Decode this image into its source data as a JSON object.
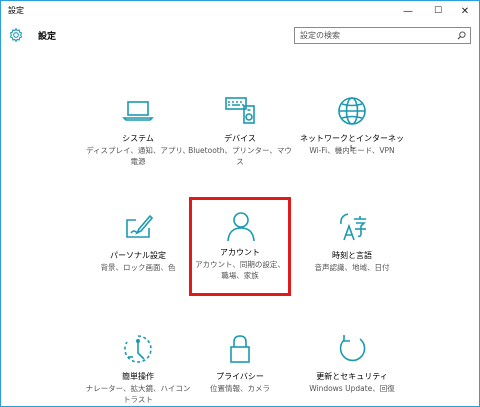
{
  "window": {
    "title": "設定",
    "minimize": "—",
    "maximize": "☐",
    "close": "✕"
  },
  "header": {
    "app_title": "設定",
    "search_placeholder": "設定の検索"
  },
  "accent_color": "#1a9ab0",
  "highlight_color": "#e01b1b",
  "tiles": [
    {
      "label": "システム",
      "desc": "ディスプレイ、通知、アプリ、電源",
      "icon": "laptop-icon"
    },
    {
      "label": "デバイス",
      "desc": "Bluetooth、プリンター、マウス",
      "icon": "devices-icon"
    },
    {
      "label": "ネットワークとインターネット",
      "desc": "Wi-Fi、機内モード、VPN",
      "icon": "globe-icon"
    },
    {
      "label": "パーソナル設定",
      "desc": "背景、ロック画面、色",
      "icon": "personalization-icon"
    },
    {
      "label": "アカウント",
      "desc": "アカウント、同期の設定、職場、家族",
      "icon": "person-icon"
    },
    {
      "label": "時刻と言語",
      "desc": "音声認識、地域、日付",
      "icon": "time-language-icon"
    },
    {
      "label": "簡単操作",
      "desc": "ナレーター、拡大鏡、ハイコントラスト",
      "icon": "ease-of-access-icon"
    },
    {
      "label": "プライバシー",
      "desc": "位置情報、カメラ",
      "icon": "lock-icon"
    },
    {
      "label": "更新とセキュリティ",
      "desc": "Windows Update、回復",
      "icon": "refresh-icon"
    }
  ]
}
